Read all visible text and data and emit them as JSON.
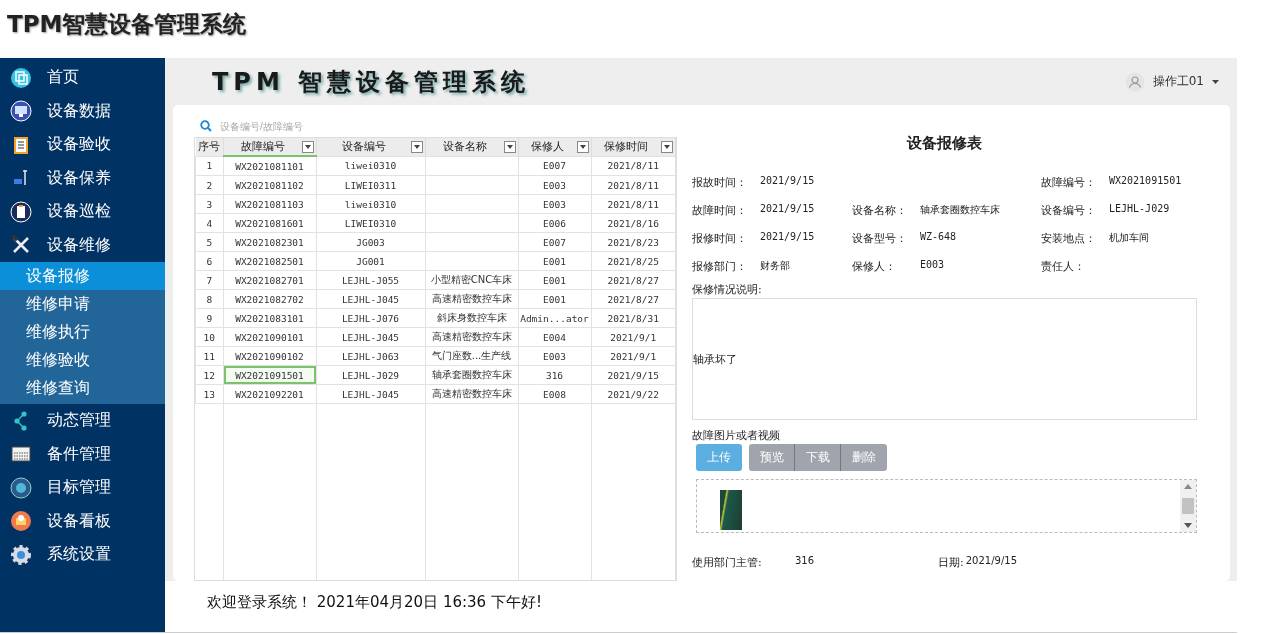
{
  "page_title": "TPM智慧设备管理系统",
  "header": {
    "title": "TPM 智慧设备管理系统",
    "user": "操作工01"
  },
  "sidebar": {
    "items": [
      {
        "label": "首页",
        "selected": false
      },
      {
        "label": "设备数据",
        "selected": false
      },
      {
        "label": "设备验收",
        "selected": false
      },
      {
        "label": "设备保养",
        "selected": false
      },
      {
        "label": "设备巡检",
        "selected": false
      },
      {
        "label": "设备维修",
        "selected": false,
        "expanded": true,
        "children": [
          {
            "label": "设备报修",
            "selected": true
          },
          {
            "label": "维修申请",
            "selected": false
          },
          {
            "label": "维修执行",
            "selected": false
          },
          {
            "label": "维修验收",
            "selected": false
          },
          {
            "label": "维修查询",
            "selected": false
          }
        ]
      },
      {
        "label": "动态管理",
        "selected": false
      },
      {
        "label": "备件管理",
        "selected": false
      },
      {
        "label": "目标管理",
        "selected": false
      },
      {
        "label": "设备看板",
        "selected": false
      },
      {
        "label": "系统设置",
        "selected": false
      }
    ]
  },
  "search": {
    "placeholder": "设备编号/故障编号"
  },
  "table": {
    "columns": [
      {
        "label": "序号",
        "filter": false,
        "selected": false
      },
      {
        "label": "故障编号",
        "filter": true,
        "selected": true
      },
      {
        "label": "设备编号",
        "filter": true,
        "selected": false
      },
      {
        "label": "设备名称",
        "filter": true,
        "selected": false
      },
      {
        "label": "保修人",
        "filter": true,
        "selected": false
      },
      {
        "label": "保修时间",
        "filter": true,
        "selected": false
      }
    ],
    "rows": [
      {
        "cells": [
          "1",
          "WX2021081101",
          "liwei0310",
          "",
          "E007",
          "2021/8/11"
        ],
        "selected": false
      },
      {
        "cells": [
          "2",
          "WX2021081102",
          "LIWEI0311",
          "",
          "E003",
          "2021/8/11"
        ],
        "selected": false
      },
      {
        "cells": [
          "3",
          "WX2021081103",
          "liwei0310",
          "",
          "E003",
          "2021/8/11"
        ],
        "selected": false
      },
      {
        "cells": [
          "4",
          "WX2021081601",
          "LIWEI0310",
          "",
          "E006",
          "2021/8/16"
        ],
        "selected": false
      },
      {
        "cells": [
          "5",
          "WX2021082301",
          "JG003",
          "",
          "E007",
          "2021/8/23"
        ],
        "selected": false
      },
      {
        "cells": [
          "6",
          "WX2021082501",
          "JG001",
          "",
          "E001",
          "2021/8/25"
        ],
        "selected": false
      },
      {
        "cells": [
          "7",
          "WX2021082701",
          "LEJHL-J055",
          "小型精密CNC车床",
          "E001",
          "2021/8/27"
        ],
        "selected": false
      },
      {
        "cells": [
          "8",
          "WX2021082702",
          "LEJHL-J045",
          "高速精密数控车床",
          "E001",
          "2021/8/27"
        ],
        "selected": false
      },
      {
        "cells": [
          "9",
          "WX2021083101",
          "LEJHL-J076",
          "斜床身数控车床",
          "Admin...ator",
          "2021/8/31"
        ],
        "selected": false
      },
      {
        "cells": [
          "10",
          "WX2021090101",
          "LEJHL-J045",
          "高速精密数控车床",
          "E004",
          "2021/9/1"
        ],
        "selected": false
      },
      {
        "cells": [
          "11",
          "WX2021090102",
          "LEJHL-J063",
          "气门座数...生产线",
          "E003",
          "2021/9/1"
        ],
        "selected": false
      },
      {
        "cells": [
          "12",
          "WX2021091501",
          "LEJHL-J029",
          "轴承套圈数控车床",
          "316",
          "2021/9/15"
        ],
        "selected": true
      },
      {
        "cells": [
          "13",
          "WX2021092201",
          "LEJHL-J045",
          "高速精密数控车床",
          "E008",
          "2021/9/22"
        ],
        "selected": false
      }
    ]
  },
  "form": {
    "title": "设备报修表",
    "rows": [
      [
        {
          "label": "报故时间：",
          "value": "2021/9/15"
        },
        null,
        {
          "label": "故障编号：",
          "value": "WX2021091501"
        }
      ],
      [
        {
          "label": "故障时间：",
          "value": "2021/9/15"
        },
        {
          "label": "设备名称：",
          "value": "轴承套圈数控车床"
        },
        {
          "label": "设备编号：",
          "value": "LEJHL-J029"
        }
      ],
      [
        {
          "label": "报修时间：",
          "value": "2021/9/15"
        },
        {
          "label": "设备型号：",
          "value": "WZ-648"
        },
        {
          "label": "安装地点：",
          "value": "机加车间"
        }
      ],
      [
        {
          "label": "报修部门：",
          "value": "财务部"
        },
        {
          "label": "保修人：",
          "value": "E003"
        },
        {
          "label": "责任人："
        }
      ]
    ],
    "description_label": "保修情况说明:",
    "description": "轴承坏了",
    "attachments_label": "故障图片或者视频",
    "upload_button": "上传",
    "buttons": [
      "预览",
      "下载",
      "删除"
    ],
    "supervisor_label": "使用部门主管:",
    "supervisor": "316",
    "date_label": "日期:",
    "date": "2021/9/15"
  },
  "footer": "欢迎登录系统！ 2021年04月20日 16:36 下午好!"
}
